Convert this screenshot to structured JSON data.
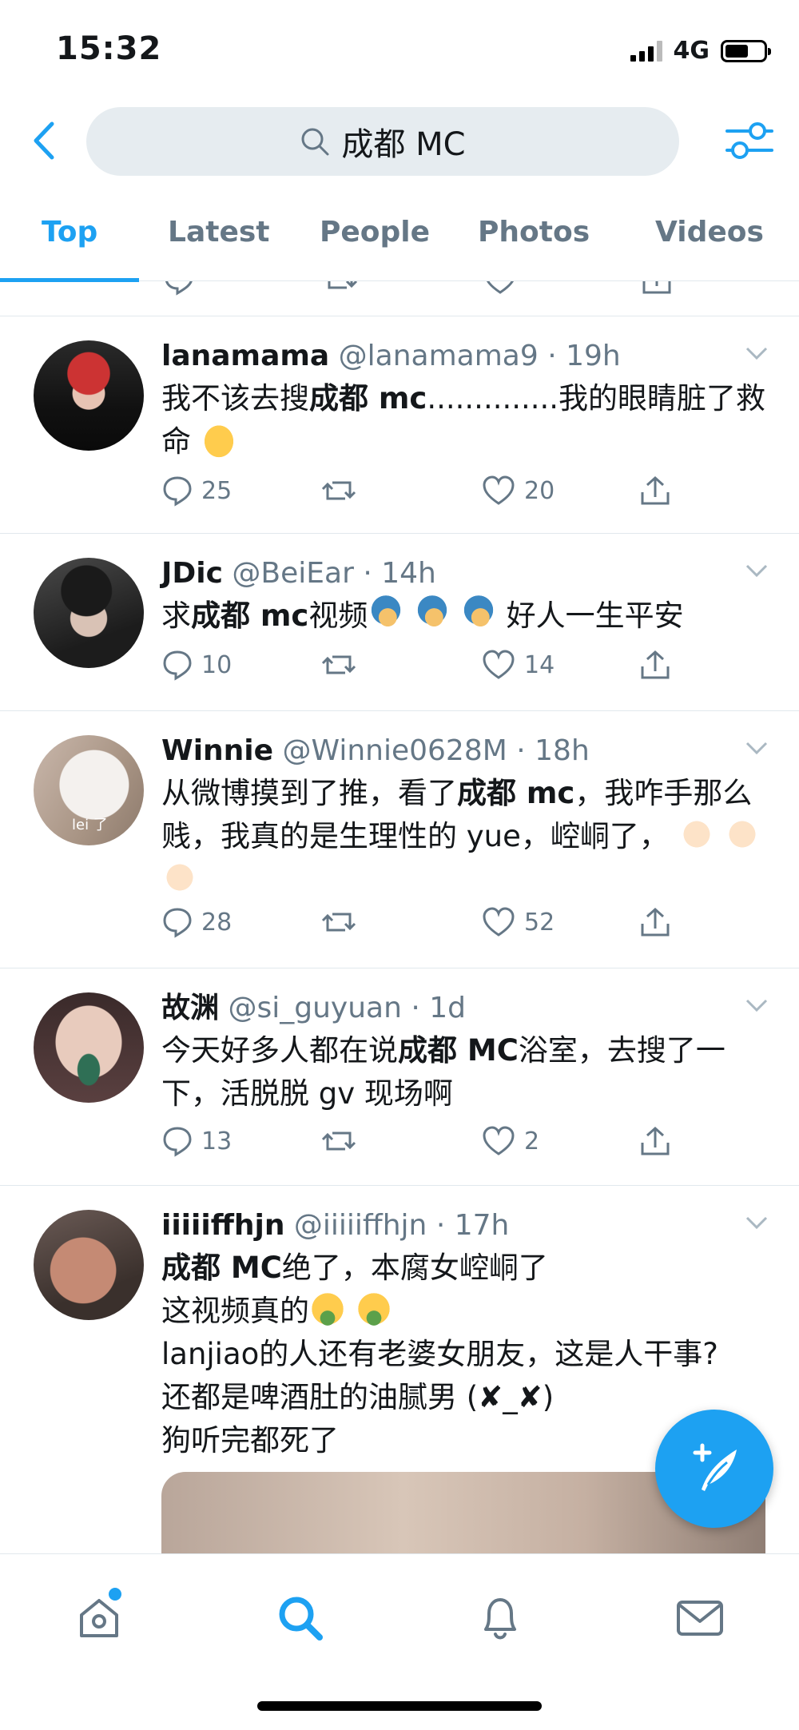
{
  "status_bar": {
    "time": "15:32",
    "network": "4G"
  },
  "search": {
    "query": "成都 MC"
  },
  "tabs": [
    {
      "label": "Top"
    },
    {
      "label": "Latest"
    },
    {
      "label": "People"
    },
    {
      "label": "Photos"
    },
    {
      "label": "Videos"
    }
  ],
  "partial_tweet": {
    "reply_count": "",
    "like_count": ""
  },
  "tweets": [
    {
      "display_name": "lanamama",
      "handle": "@lanamama9",
      "time": "19h",
      "text_before": "我不该去搜",
      "text_bold": "成都 mc",
      "text_after": "..............我的眼睛脏了救命",
      "reply_count": "25",
      "retweet_count": "",
      "like_count": "20"
    },
    {
      "display_name": "JDic",
      "handle": "@BeiEar",
      "time": "14h",
      "text_before": "求",
      "text_bold": "成都 mc",
      "text_after": "视频",
      "text_tail": "好人一生平安",
      "reply_count": "10",
      "retweet_count": "",
      "like_count": "14"
    },
    {
      "display_name": "Winnie",
      "handle": "@Winnie0628M",
      "time": "18h",
      "text_before": "从微博摸到了推，看了",
      "text_bold": "成都 mc",
      "text_after": "，我咋手那么贱，我真的是生理性的 yue，崆峒了，",
      "avatar_caption": "lei 了",
      "reply_count": "28",
      "retweet_count": "",
      "like_count": "52"
    },
    {
      "display_name": "故渊",
      "handle": "@si_guyuan",
      "time": "1d",
      "text_before": "今天好多人都在说",
      "text_bold": "成都 MC",
      "text_after": "浴室，去搜了一下，活脱脱 gv 现场啊",
      "reply_count": "13",
      "retweet_count": "",
      "like_count": "2"
    },
    {
      "display_name": "iiiiiffhjn",
      "handle": "@iiiiiffhjn",
      "time": "17h",
      "text_bold": "成都 MC",
      "line1_after": "绝了，本腐女崆峒了",
      "line2": "这视频真的",
      "line3": "lanjiao的人还有老婆女朋友，这是人干事?",
      "line4": "还都是啤酒肚的油腻男 (✘_✘)",
      "line5": "狗听完都死了"
    }
  ],
  "colors": {
    "accent": "#1da1f2",
    "text": "#14171a",
    "secondary_text": "#657786",
    "divider": "#e1e8ed",
    "search_bg": "#e6ecf0"
  },
  "icons": [
    "back-icon",
    "search-icon",
    "filter-icon",
    "reply-icon",
    "retweet-icon",
    "like-icon",
    "share-icon",
    "caret-icon",
    "compose-icon",
    "home-icon",
    "explore-icon",
    "notifications-icon",
    "messages-icon"
  ]
}
